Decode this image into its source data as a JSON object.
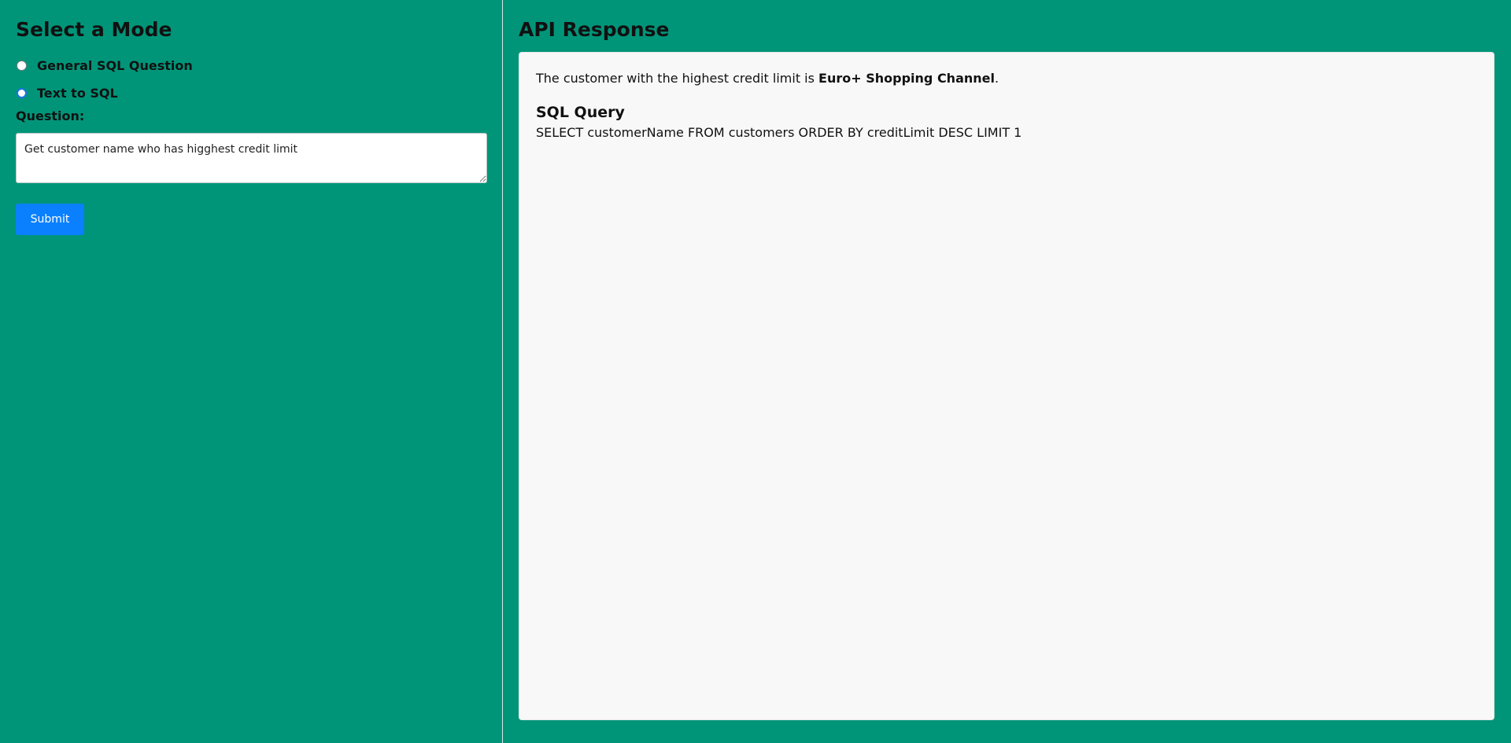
{
  "left_panel": {
    "title": "Select a Mode",
    "modes": [
      {
        "label": "General SQL Question",
        "selected": false
      },
      {
        "label": "Text to SQL",
        "selected": true
      }
    ],
    "question_label": "Question:",
    "question_value": "Get customer name who has higghest credit limit",
    "submit_label": "Submit"
  },
  "right_panel": {
    "title": "API Response",
    "response_prefix": "The customer with the highest credit limit is ",
    "response_bold": "Euro+ Shopping Channel",
    "response_suffix": ".",
    "sql_title": "SQL Query",
    "sql_query": "SELECT customerName FROM customers ORDER BY creditLimit DESC LIMIT 1"
  },
  "colors": {
    "page_background": "#009579",
    "submit_button": "#0a80ff",
    "response_card": "#f8f8f8"
  }
}
